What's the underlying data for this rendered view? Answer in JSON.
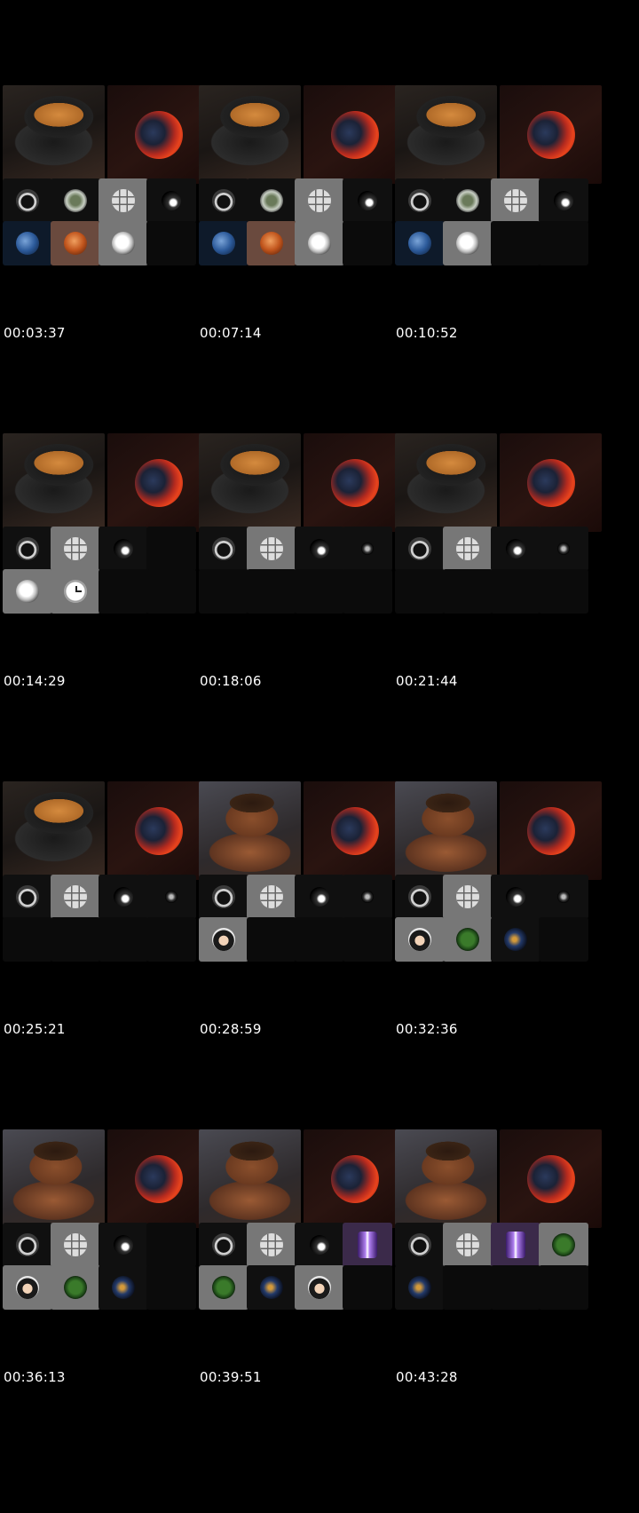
{
  "frames": [
    {
      "time": "00:03:37",
      "main": "black",
      "tiles": [
        "arch",
        "tree",
        "grid",
        "swirl",
        "earth",
        "mars",
        "eagle",
        ""
      ]
    },
    {
      "time": "00:07:14",
      "main": "black",
      "tiles": [
        "arch",
        "tree",
        "grid",
        "swirl",
        "earth",
        "mars",
        "eagle",
        ""
      ]
    },
    {
      "time": "00:10:52",
      "main": "black",
      "tiles": [
        "arch",
        "tree",
        "grid",
        "swirl",
        "earth",
        "eagle",
        "",
        ""
      ]
    },
    {
      "time": "00:14:29",
      "main": "black",
      "tiles": [
        "arch",
        "grid",
        "swirl",
        "",
        "eagle",
        "clock",
        "",
        ""
      ]
    },
    {
      "time": "00:18:06",
      "main": "black",
      "tiles": [
        "arch",
        "grid",
        "swirl",
        "dot",
        "",
        "",
        "",
        ""
      ]
    },
    {
      "time": "00:21:44",
      "main": "black",
      "tiles": [
        "arch",
        "grid",
        "swirl",
        "dot",
        "",
        "",
        "",
        ""
      ]
    },
    {
      "time": "00:25:21",
      "main": "black",
      "tiles": [
        "arch",
        "grid",
        "swirl",
        "dot",
        "",
        "",
        "",
        ""
      ]
    },
    {
      "time": "00:28:59",
      "main": "copper",
      "tiles": [
        "arch",
        "grid",
        "swirl",
        "dot",
        "face",
        "",
        "",
        ""
      ]
    },
    {
      "time": "00:32:36",
      "main": "copper",
      "tiles": [
        "arch",
        "grid",
        "swirl",
        "dot",
        "face",
        "leaf",
        "nebula",
        ""
      ]
    },
    {
      "time": "00:36:13",
      "main": "copper",
      "tiles": [
        "arch",
        "grid",
        "swirl",
        "",
        "face",
        "leaf",
        "nebula",
        ""
      ]
    },
    {
      "time": "00:39:51",
      "main": "copper",
      "tiles": [
        "arch",
        "grid",
        "swirl",
        "prism",
        "leaf",
        "nebula",
        "face",
        ""
      ]
    },
    {
      "time": "00:43:28",
      "main": "copper",
      "tiles": [
        "arch",
        "grid",
        "prism",
        "leaf",
        "nebula",
        "",
        "",
        ""
      ]
    }
  ]
}
